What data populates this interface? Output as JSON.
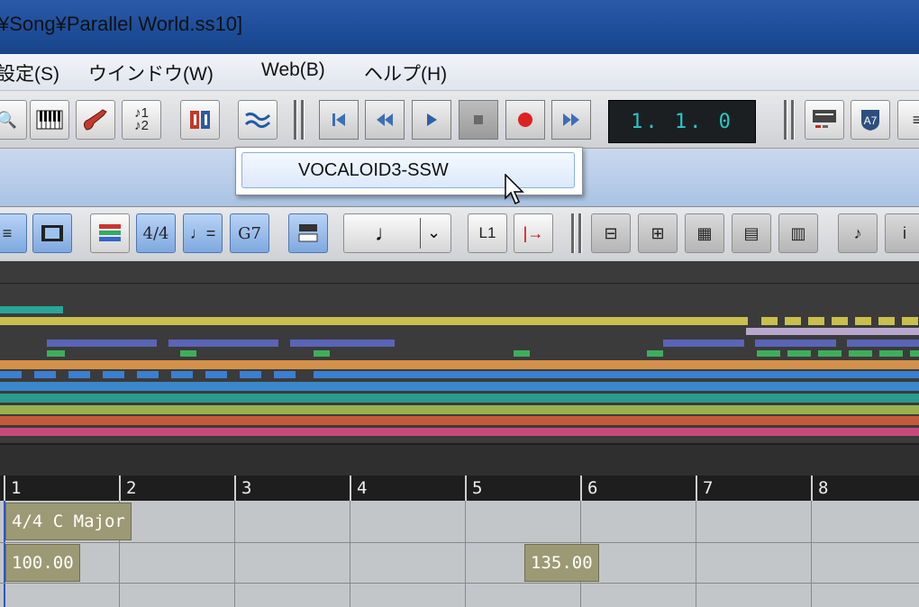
{
  "window": {
    "title": "¥Song¥Parallel World.ss10]"
  },
  "menu": [
    {
      "label": "設定(S)"
    },
    {
      "label": "ウインドウ(W)"
    },
    {
      "label": "Web(B)"
    },
    {
      "label": "ヘルプ(H)"
    }
  ],
  "toolbar1": {
    "icons": [
      "zoom-icon",
      "piano-icon",
      "guitar-icon",
      "score-icon",
      "mixer-icon",
      "vocaloid-icon"
    ],
    "counter": "1. 1.  0",
    "chord_badge": "A7"
  },
  "dropdown": {
    "item": "VOCALOID3-SSW"
  },
  "toolbar2": {
    "time_sig_label": "4/4",
    "tempo_label": "♩=",
    "chord_label": "G7",
    "note_value": "♩",
    "quantize_label": "L1",
    "goto_label": "|→"
  },
  "ruler": {
    "measures": [
      "1",
      "2",
      "3",
      "4",
      "5",
      "6",
      "7",
      "8"
    ]
  },
  "events": {
    "signature": "4/4 C Major",
    "tempo_a": "100.00",
    "tempo_b": "135.00"
  },
  "colors": {
    "accent_blue": "#7fa9e0",
    "lcd_text": "#28c7c7",
    "event_bg": "#9c9a74"
  }
}
